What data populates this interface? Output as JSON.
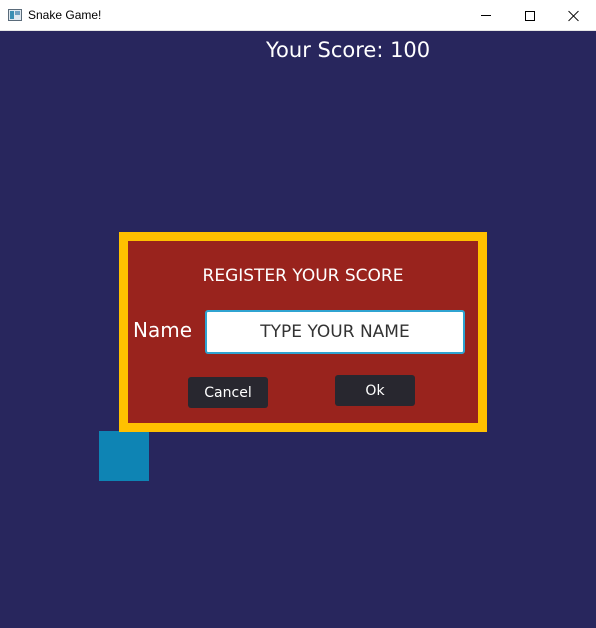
{
  "window": {
    "title": "Snake Game!",
    "controls": [
      "minimize",
      "maximize",
      "close"
    ]
  },
  "game": {
    "score_label": "Your Score: 100",
    "background_color": "#28265d",
    "snake_color": "#0e84b4"
  },
  "dialog": {
    "title": "REGISTER YOUR SCORE",
    "name_label": "Name",
    "name_placeholder": "TYPE YOUR NAME",
    "name_value": "",
    "cancel_label": "Cancel",
    "ok_label": "Ok",
    "border_color": "#ffc000",
    "background_color": "#99231d"
  }
}
